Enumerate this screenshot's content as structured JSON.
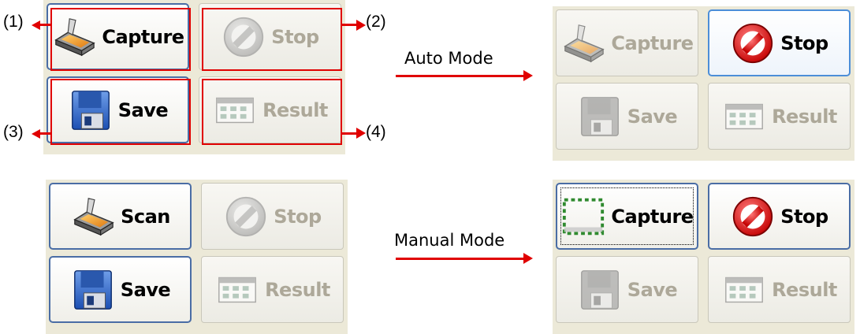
{
  "callouts": [
    "(1)",
    "(2)",
    "(3)",
    "(4)"
  ],
  "modes": {
    "auto": "Auto Mode",
    "manual": "Manual Mode"
  },
  "colors": {
    "highlight": "#e00000",
    "panel_bg": "#ece9d8",
    "enabled_border": "#4a6da5",
    "disabled_text": "#ada899"
  },
  "panels": {
    "initial": {
      "buttons": [
        {
          "label": "Capture",
          "icon": "scanner-icon",
          "state": "enabled"
        },
        {
          "label": "Stop",
          "icon": "stop-icon",
          "state": "disabled"
        },
        {
          "label": "Save",
          "icon": "floppy-disk-icon",
          "state": "enabled"
        },
        {
          "label": "Result",
          "icon": "result-grid-icon",
          "state": "disabled"
        }
      ]
    },
    "auto": {
      "buttons": [
        {
          "label": "Capture",
          "icon": "scanner-icon",
          "state": "disabled"
        },
        {
          "label": "Stop",
          "icon": "stop-icon",
          "state": "hover"
        },
        {
          "label": "Save",
          "icon": "floppy-disk-icon",
          "state": "disabled"
        },
        {
          "label": "Result",
          "icon": "result-grid-icon",
          "state": "disabled"
        }
      ]
    },
    "manual_initial": {
      "buttons": [
        {
          "label": "Scan",
          "icon": "scanner-icon",
          "state": "enabled"
        },
        {
          "label": "Stop",
          "icon": "stop-icon",
          "state": "disabled"
        },
        {
          "label": "Save",
          "icon": "floppy-disk-icon",
          "state": "enabled"
        },
        {
          "label": "Result",
          "icon": "result-grid-icon",
          "state": "disabled"
        }
      ]
    },
    "manual": {
      "buttons": [
        {
          "label": "Capture",
          "icon": "selection-rect-icon",
          "state": "focused"
        },
        {
          "label": "Stop",
          "icon": "stop-icon",
          "state": "enabled"
        },
        {
          "label": "Save",
          "icon": "floppy-disk-icon",
          "state": "disabled"
        },
        {
          "label": "Result",
          "icon": "result-grid-icon",
          "state": "disabled"
        }
      ]
    }
  }
}
